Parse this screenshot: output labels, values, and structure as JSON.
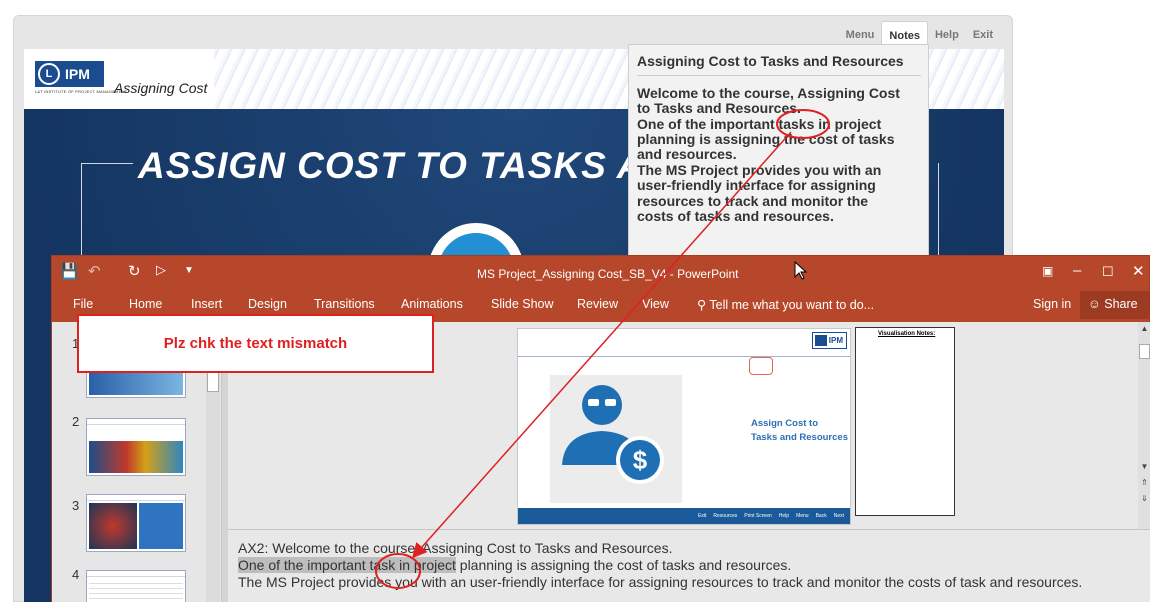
{
  "course": {
    "nav_tabs": [
      {
        "label": "Menu"
      },
      {
        "label": "Notes"
      },
      {
        "label": "Help"
      },
      {
        "label": "Exit"
      }
    ],
    "logo_text": "IPM",
    "logo_subtext": "L&T INSTITUTE OF PROJECT MANAGEMENT",
    "subtitle": "Assigning Cost",
    "slide_title": "ASSIGN COST TO TASKS AN",
    "notes_popup": {
      "title": "Assigning Cost to Tasks and Resources",
      "lines": [
        "Welcome to the course, Assigning Cost",
        "to Tasks and Resources.",
        "One of the important tasks in project",
        "planning is assigning the cost of tasks",
        "and resources.",
        "The MS Project provides you with an",
        "user-friendly interface for assigning",
        "resources to track and monitor the",
        "costs of tasks and resources."
      ]
    }
  },
  "powerpoint": {
    "window_title": "MS Project_Assigning Cost_SB_V4 - PowerPoint",
    "ribbon_tabs": [
      {
        "label": "File"
      },
      {
        "label": "Home"
      },
      {
        "label": "Insert"
      },
      {
        "label": "Design"
      },
      {
        "label": "Transitions"
      },
      {
        "label": "Animations"
      },
      {
        "label": "Slide Show"
      },
      {
        "label": "Review"
      },
      {
        "label": "View"
      }
    ],
    "tell_me": "Tell me what you want to do...",
    "sign_in": "Sign in",
    "share": "Share",
    "slide_numbers": [
      "1",
      "2",
      "3",
      "4"
    ],
    "slide": {
      "logo": "IPM",
      "title_line1": "Assign Cost to",
      "title_line2": "Tasks and Resources",
      "footer_items": [
        "Exit",
        "Resources",
        "Print Screen",
        "Help",
        "Menu",
        "Back",
        "Next"
      ],
      "visualisation_notes_label": "Visualisation Notes:"
    },
    "notes": {
      "line1": "AX2: Welcome to the course, Assigning Cost to Tasks and Resources.",
      "line2_highlight": "One of the important task in project",
      "line2_rest": " planning is assigning the cost of tasks and resources.",
      "line3": "The MS Project provides you with an user-friendly interface for assigning resources to track and monitor the costs of task and resources."
    }
  },
  "annotation": {
    "callout_text": "Plz chk the text mismatch",
    "color": "#e02020"
  },
  "colors": {
    "ppt_accent": "#b7472a",
    "course_blue": "#163a66",
    "slide_link_blue": "#2c6fb5"
  }
}
